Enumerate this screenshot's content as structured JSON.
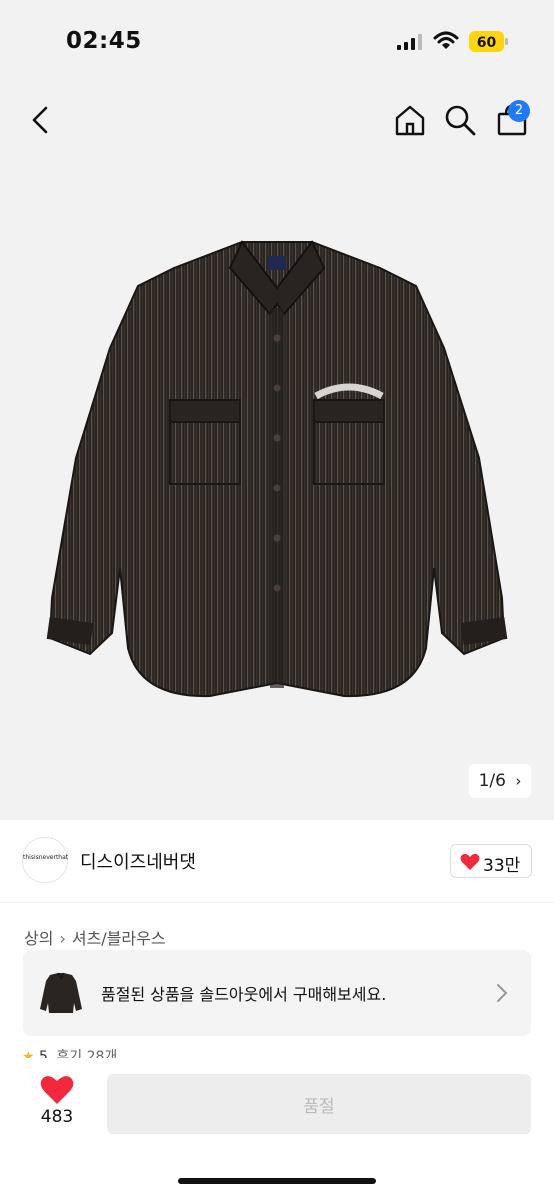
{
  "status_bar": {
    "time": "02:45",
    "battery": "60"
  },
  "header": {
    "cart_count": "2"
  },
  "gallery": {
    "pager": "1/6"
  },
  "brand": {
    "logo_text": "thisisneverthat",
    "name": "디스이즈네버댓",
    "likes": "33만"
  },
  "breadcrumb": {
    "category": "상의",
    "subcategory": "셔츠/블라우스"
  },
  "soldout_banner": {
    "text": "품절된 상품을 솔드아웃에서 구매해보세요."
  },
  "rating": {
    "score": "5",
    "reviews": "후기 28개"
  },
  "bottom_bar": {
    "like_count": "483",
    "buy_label": "품절"
  },
  "colors": {
    "accent_red": "#f2283c",
    "badge_blue": "#1f7aff",
    "battery_yellow": "#ffd60a",
    "star": "#f3b523"
  }
}
